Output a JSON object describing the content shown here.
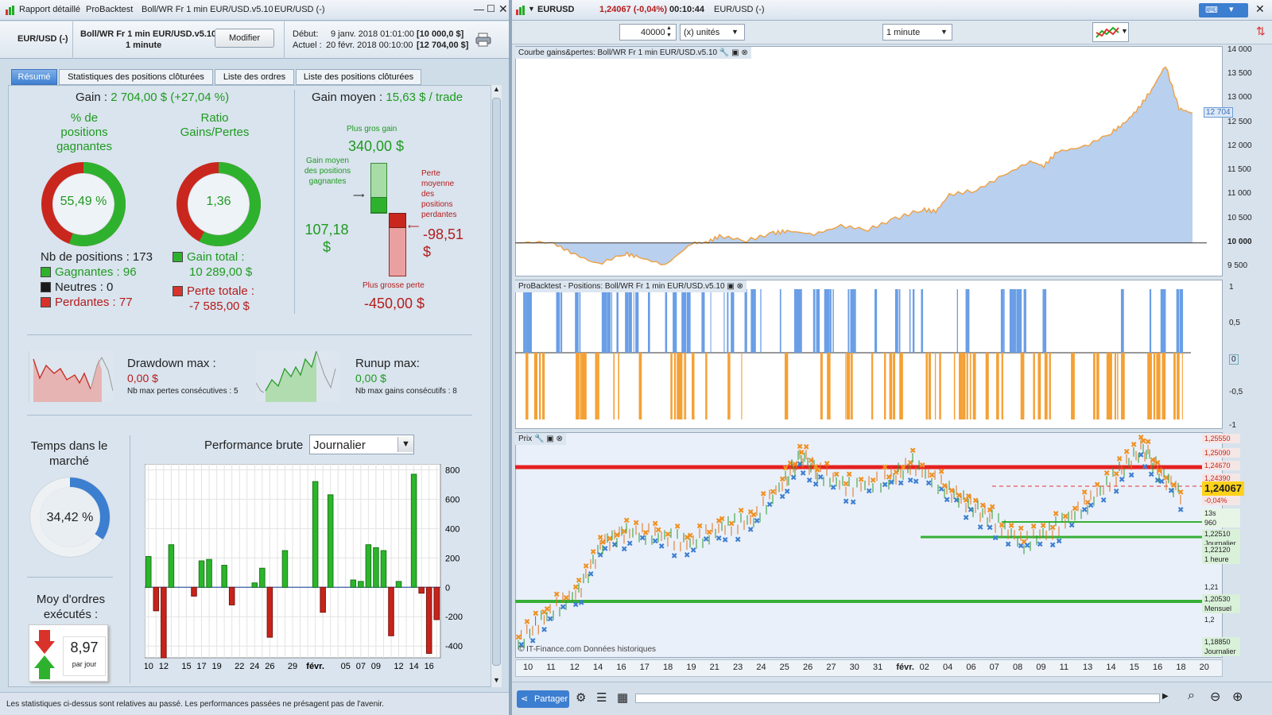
{
  "left_window": {
    "tabs_top": [
      "Rapport détaillé",
      "ProBacktest",
      "Boll/WR Fr 1 min EUR/USD.v5.10",
      "EUR/USD (-)"
    ],
    "instrument": "EUR/USD (-)",
    "strategy_name": "Boll/WR Fr 1 min EUR/USD.v5.10",
    "timeframe": "1 minute",
    "modify_button": "Modifier",
    "start_label": "Début:",
    "start_date": "9 janv. 2018 01:01:00",
    "start_value": "[10 000,0 $]",
    "current_label": "Actuel :",
    "current_date": "20 févr. 2018 00:10:00",
    "current_value": "[12 704,00 $]",
    "report_tabs": [
      "Résumé",
      "Statistiques des positions clôturées",
      "Liste des ordres",
      "Liste des positions clôturées"
    ],
    "gain_label": "Gain :",
    "gain_value": "2 704,00 $ (+27,04 %)",
    "avg_gain_label": "Gain moyen :",
    "avg_gain_value": "15,63 $ / trade",
    "pct_winning_title": "% de positions gagnantes",
    "pct_winning_value": "55,49 %",
    "pct_winning_fraction": 0.5549,
    "ratio_title": "Ratio Gains/Pertes",
    "ratio_value": "1,36",
    "ratio_gain_fraction": 0.5757,
    "nb_positions": "Nb de positions : 173",
    "winners": "Gagnantes : 96",
    "neutral": "Neutres : 0",
    "losers": "Perdantes : 77",
    "total_gain_label": "Gain total :",
    "total_gain_value": "10 289,00 $",
    "total_loss_label": "Perte totale :",
    "total_loss_value": "-7 585,00 $",
    "biggest_gain_label": "Plus gros gain",
    "biggest_gain_value": "340,00 $",
    "avg_win_label": "Gain moyen des positions gagnantes",
    "avg_win_value": "107,18 $",
    "avg_loss_label": "Perte moyenne des positions perdantes",
    "avg_loss_value": "-98,51 $",
    "biggest_loss_label": "Plus grosse perte",
    "biggest_loss_value": "-450,00 $",
    "drawdown_title": "Drawdown max :",
    "drawdown_value": "0,00 $",
    "drawdown_sub": "Nb max pertes consécutives : 5",
    "runup_title": "Runup max:",
    "runup_value": "0,00 $",
    "runup_sub": "Nb max gains consécutifs : 8",
    "time_in_market_title": "Temps dans le marché",
    "time_in_market_value": "34,42 %",
    "time_in_market_fraction": 0.3442,
    "avg_orders_title": "Moy d'ordres exécutés :",
    "avg_orders_value": "8,97",
    "avg_orders_unit": "par jour",
    "perf_title": "Performance brute",
    "perf_period": "Journalier",
    "disclaimer": "Les statistiques ci-dessus sont relatives au passé. Les performances passées ne présagent pas de l'avenir."
  },
  "right_window": {
    "symbol": "EURUSD",
    "price_change": "1,24067 (-0,04%)",
    "time": "00:10:44",
    "instrument": "EUR/USD (-)",
    "quantity": "40000",
    "unit_label": "(x) unités",
    "interval": "1 minute",
    "equity_title": "Courbe gains&pertes: Boll/WR Fr 1 min EUR/USD.v5.10",
    "positions_title": "ProBacktest - Positions: Boll/WR Fr 1 min EUR/USD.v5.10",
    "price_title": "Prix",
    "equity_axis": [
      "14 000",
      "13 500",
      "13 000",
      "12 500",
      "12 000",
      "11 500",
      "11 000",
      "10 500",
      "10 000",
      "9 500"
    ],
    "equity_current": "12 704",
    "positions_axis": [
      "1",
      "0,5",
      "0",
      "-0,5",
      "-1"
    ],
    "price_tags": [
      "1,25550",
      "1,25090",
      "1,24670",
      "1,24390",
      "1,24067",
      "-0,04%",
      "13s",
      "960",
      "1,22510",
      "Journalier",
      "1,22120",
      "1 heure",
      "1,21",
      "1,20530",
      "Mensuel",
      "1,2",
      "1,18850",
      "Journalier"
    ],
    "date_axis": [
      "10",
      "11",
      "12",
      "14",
      "16",
      "17",
      "18",
      "19",
      "21",
      "23",
      "24",
      "25",
      "26",
      "27",
      "30",
      "31",
      "févr.",
      "02",
      "04",
      "06",
      "07",
      "08",
      "09",
      "11",
      "13",
      "14",
      "15",
      "16",
      "18",
      "20"
    ],
    "watermark": "© IT-Finance.com Données historiques",
    "share_button": "Partager"
  },
  "chart_data": [
    {
      "type": "bar",
      "title": "Performance brute",
      "categories": [
        "10",
        "11",
        "12",
        "13",
        "14",
        "15",
        "16",
        "17",
        "18",
        "19",
        "20",
        "21",
        "22",
        "23",
        "24",
        "25",
        "26",
        "27",
        "28",
        "29",
        "30",
        "31",
        "févr.",
        "02",
        "03",
        "04",
        "05",
        "06",
        "07",
        "08",
        "09",
        "10",
        "11",
        "12",
        "13",
        "14",
        "15",
        "16",
        "17"
      ],
      "values": [
        210,
        -160,
        -480,
        290,
        0,
        0,
        -60,
        180,
        190,
        0,
        150,
        -120,
        0,
        0,
        30,
        130,
        -340,
        0,
        250,
        0,
        0,
        0,
        720,
        -170,
        630,
        0,
        0,
        50,
        40,
        290,
        270,
        250,
        -330,
        40,
        0,
        770,
        -40,
        -450,
        -220
      ],
      "ylim": [
        -480,
        840
      ],
      "yticks": [
        "800",
        "600",
        "400",
        "200",
        "0",
        "-200",
        "-400"
      ],
      "xlabels_shown": [
        "10",
        "12",
        "15",
        "17",
        "19",
        "22",
        "24",
        "26",
        "29",
        "févr.",
        "05",
        "07",
        "09",
        "12",
        "14",
        "16"
      ],
      "colors": {
        "positive": "#2bb52b",
        "negative": "#c8231a"
      }
    },
    {
      "type": "area",
      "title": "Courbe gains&pertes: Boll/WR Fr 1 min EUR/USD.v5.10",
      "ylim": [
        9300,
        14100
      ],
      "baseline": 10000,
      "x_index": [
        0,
        5,
        8,
        12,
        16,
        18,
        22,
        26,
        28,
        30,
        34,
        38,
        40,
        44,
        48,
        52,
        56,
        60,
        62,
        64,
        68,
        72,
        76,
        78,
        80,
        84,
        88,
        90,
        92,
        94,
        96,
        98,
        100
      ],
      "values": [
        10000,
        10020,
        9800,
        9550,
        9780,
        9700,
        9540,
        10000,
        10000,
        10140,
        10050,
        10200,
        10250,
        10180,
        10350,
        10280,
        10500,
        10700,
        10650,
        11000,
        11100,
        11400,
        11700,
        11600,
        11900,
        12000,
        12300,
        12500,
        12800,
        13200,
        13700,
        12800,
        12700
      ]
    }
  ]
}
